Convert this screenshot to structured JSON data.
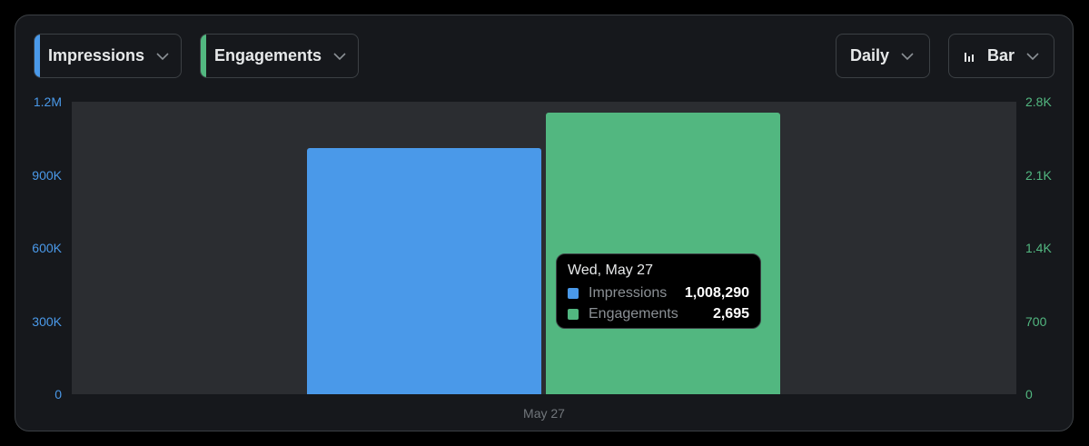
{
  "controls": {
    "impressions": {
      "label": "Impressions",
      "color": "#4a99e9",
      "icon": "chevron-down-icon"
    },
    "engagements": {
      "label": "Engagements",
      "color": "#52b780",
      "icon": "chevron-down-icon"
    },
    "interval": {
      "label": "Daily",
      "icon": "chevron-down-icon"
    },
    "chart_type": {
      "label": "Bar",
      "icon": "bar-chart-icon"
    }
  },
  "tooltip": {
    "date": "Wed, May 27",
    "rows": [
      {
        "name": "Impressions",
        "value": "1,008,290",
        "color": "#4a99e9"
      },
      {
        "name": "Engagements",
        "value": "2,695",
        "color": "#52b780"
      }
    ]
  },
  "chart_data": {
    "type": "bar",
    "categories": [
      "May 27"
    ],
    "series": [
      {
        "name": "Impressions",
        "values": [
          1008290
        ],
        "axis": "left",
        "color": "#4a99e9"
      },
      {
        "name": "Engagements",
        "values": [
          2695
        ],
        "axis": "right",
        "color": "#52b780"
      }
    ],
    "y_left": {
      "ylim": [
        0,
        1200000
      ],
      "ticks": [
        "0",
        "300K",
        "600K",
        "900K",
        "1.2M"
      ],
      "color": "#4a99e9"
    },
    "y_right": {
      "ylim": [
        0,
        2800
      ],
      "ticks": [
        "0",
        "700",
        "1.4K",
        "2.1K",
        "2.8K"
      ],
      "color": "#52b780"
    },
    "x_tick_labels": [
      "May 27"
    ],
    "grid": false
  }
}
